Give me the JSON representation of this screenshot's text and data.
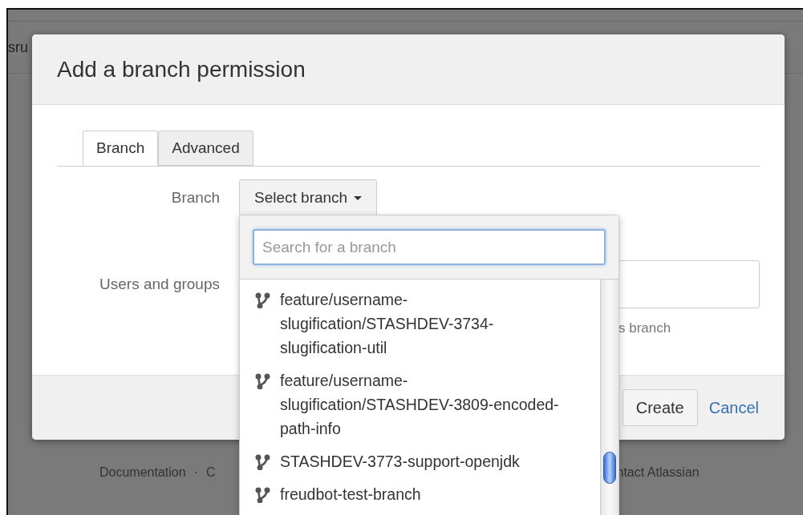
{
  "background_page": {
    "header_text": "sru",
    "footer_links": [
      "Documentation",
      "·",
      "C",
      "ntact Atlassian"
    ]
  },
  "dialog": {
    "title": "Add a branch permission",
    "tabs": [
      {
        "label": "Branch",
        "selected": true
      },
      {
        "label": "Advanced",
        "selected": false
      }
    ],
    "branch_field": {
      "label": "Branch",
      "button": "Select branch"
    },
    "users_field": {
      "label": "Users and groups",
      "hint": "s branch"
    },
    "buttons": [
      {
        "kind": "primary",
        "label": "Create"
      },
      {
        "kind": "link",
        "label": "Cancel"
      }
    ]
  },
  "branch_dropdown": {
    "search": {
      "placeholder": "Search for a branch"
    },
    "items": [
      {
        "name": "feature/username-slugification/STASHDEV-3734-slugification-util"
      },
      {
        "name": "feature/username-slugification/STASHDEV-3809-encoded-path-info"
      },
      {
        "name": "STASHDEV-3773-support-openjdk"
      },
      {
        "name": "freudbot-test-branch"
      }
    ]
  }
}
